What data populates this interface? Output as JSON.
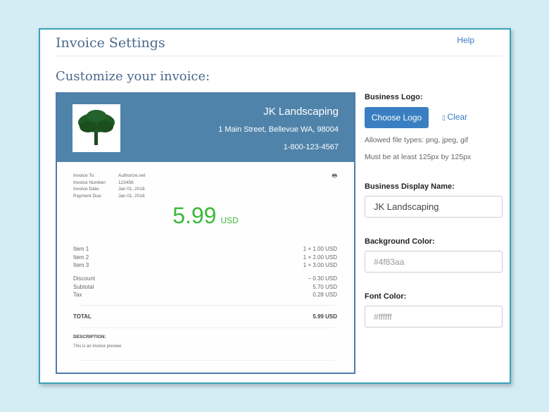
{
  "header": {
    "title": "Invoice Settings",
    "help": "Help",
    "subtitle": "Customize your invoice:"
  },
  "invoice": {
    "business_name": "JK Landscaping",
    "address": "1 Main Street, Bellevue WA, 98004",
    "phone": "1-800-123-4567",
    "meta": [
      {
        "label": "Invoice To:",
        "value": "Authorize.net"
      },
      {
        "label": "Invoice Number:",
        "value": "123456"
      },
      {
        "label": "Invoice Date:",
        "value": "Jan 01, 2018"
      },
      {
        "label": "Payment Due:",
        "value": "Jan 01, 2018"
      }
    ],
    "amount": "5.99",
    "currency": "USD",
    "items": [
      {
        "name": "Item 1",
        "value": "1 × 1.00 USD"
      },
      {
        "name": "Item 2",
        "value": "1 × 2.00 USD"
      },
      {
        "name": "Item 3",
        "value": "1 × 3.00 USD"
      }
    ],
    "summary": [
      {
        "name": "Discount",
        "value": "− 0.30 USD"
      },
      {
        "name": "Subtotal",
        "value": "5.70 USD"
      },
      {
        "name": "Tax",
        "value": "0.28 USD"
      }
    ],
    "total_label": "TOTAL",
    "total_value": "5.99 USD",
    "description_label": "DESCRIPTION:",
    "description": "This is an invoice preview",
    "header_color": "#4f83aa",
    "amount_color": "#3cb83c"
  },
  "settings": {
    "logo_label": "Business Logo:",
    "choose_logo": "Choose Logo",
    "clear": "Clear",
    "hint1": "Allowed file types: png, jpeg, gif",
    "hint2": "Must be at least 125px by 125px",
    "name_label": "Business Display Name:",
    "name_value": "JK Landscaping",
    "bg_label": "Background Color:",
    "bg_placeholder": "#4f83aa",
    "font_label": "Font Color:",
    "font_placeholder": "#ffffff"
  }
}
